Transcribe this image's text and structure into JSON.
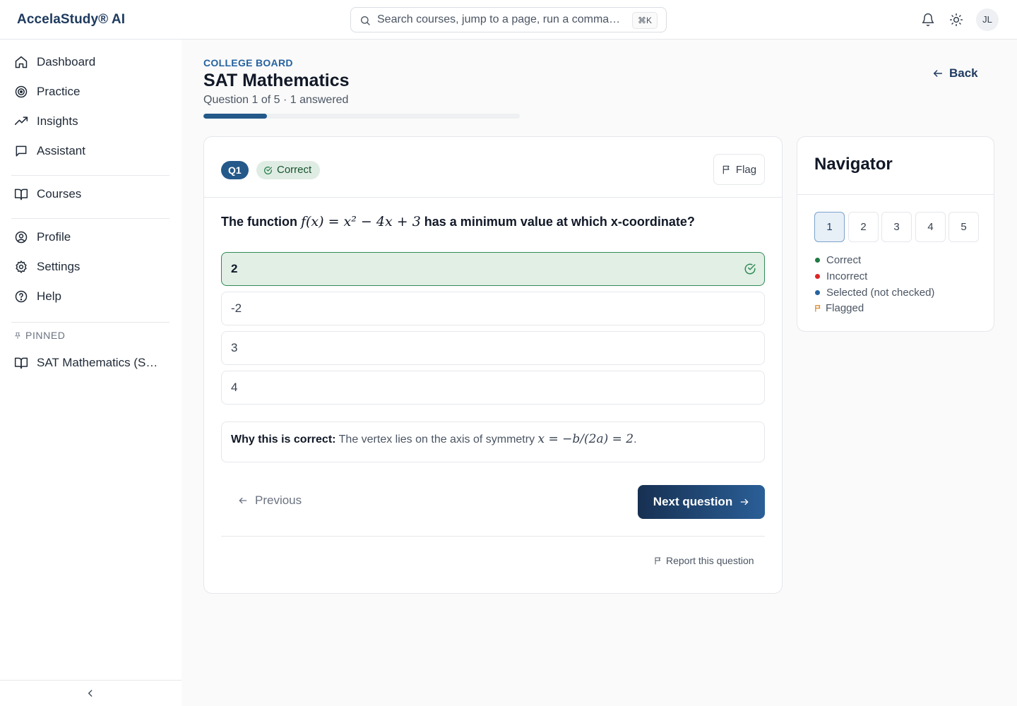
{
  "app": {
    "brand": "AccelaStudy® AI"
  },
  "search": {
    "placeholder": "Search courses, jump to a page, run a comma…",
    "shortcut": "⌘K"
  },
  "user": {
    "initials": "JL"
  },
  "sidebar": {
    "primary": [
      {
        "label": "Dashboard",
        "icon": "home-icon"
      },
      {
        "label": "Practice",
        "icon": "target-icon"
      },
      {
        "label": "Insights",
        "icon": "trending-up-icon"
      },
      {
        "label": "Assistant",
        "icon": "message-square-icon"
      }
    ],
    "courses": {
      "label": "Courses",
      "icon": "book-open-icon"
    },
    "secondary": [
      {
        "label": "Profile",
        "icon": "user-circle-icon"
      },
      {
        "label": "Settings",
        "icon": "gear-icon"
      },
      {
        "label": "Help",
        "icon": "help-circle-icon"
      }
    ],
    "pinned_heading": "PINNED",
    "pinned": [
      {
        "label": "SAT Mathematics (SAT…",
        "icon": "book-open-icon"
      }
    ]
  },
  "header": {
    "eyebrow": "COLLEGE BOARD",
    "title": "SAT Mathematics",
    "subtitle": "Question 1 of 5 · 1 answered",
    "progress_fraction": 0.2,
    "back_label": "Back"
  },
  "question": {
    "chip": "Q1",
    "status": "Correct",
    "flag_label": "Flag",
    "prompt_prefix": "The function ",
    "prompt_math": "f(x) = x² − 4x + 3",
    "prompt_suffix": " has a minimum value at which x-coordinate?",
    "options": [
      {
        "label": "2",
        "state": "correct"
      },
      {
        "label": "-2",
        "state": "none"
      },
      {
        "label": "3",
        "state": "none"
      },
      {
        "label": "4",
        "state": "none"
      }
    ],
    "explanation_label": "Why this is correct:",
    "explanation_text": " The vertex lies on the axis of symmetry ",
    "explanation_math": "x = −b/(2a) = 2",
    "explanation_end": ".",
    "prev_label": "Previous",
    "next_label": "Next question",
    "report_label": "Report this question"
  },
  "navigator": {
    "title": "Navigator",
    "questions": [
      "1",
      "2",
      "3",
      "4",
      "5"
    ],
    "current": "1",
    "legend": [
      {
        "label": "Correct",
        "color": "#1f7a45"
      },
      {
        "label": "Incorrect",
        "color": "#dc2626"
      },
      {
        "label": "Selected (not checked)",
        "color": "#2563a0"
      },
      {
        "label": "Flagged",
        "color": "#d97706"
      }
    ]
  },
  "colors": {
    "brand": "#1e3a5f",
    "accent": "#24598a",
    "success": "#2f8a55",
    "success_bg": "#e1efe5"
  }
}
